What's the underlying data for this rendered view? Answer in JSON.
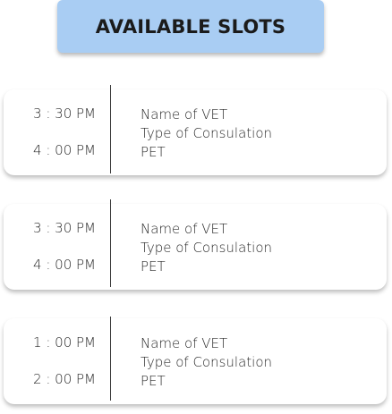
{
  "header": {
    "title": "AVAILABLE SLOTS"
  },
  "slots": [
    {
      "start_time": "3 : 30 PM",
      "end_time": "4 : 00 PM",
      "vet": "Name of VET",
      "consultation": "Type of Consulation",
      "pet": "PET"
    },
    {
      "start_time": "3 : 30 PM",
      "end_time": "4 : 00 PM",
      "vet": "Name of VET",
      "consultation": "Type of Consulation",
      "pet": "PET"
    },
    {
      "start_time": "1 : 00 PM",
      "end_time": "2 : 00 PM",
      "vet": "Name of VET",
      "consultation": "Type of Consulation",
      "pet": "PET"
    }
  ],
  "colors": {
    "header_bg": "#a9cdf3",
    "card_bg": "#ffffff",
    "text": "#2a2a2a"
  }
}
